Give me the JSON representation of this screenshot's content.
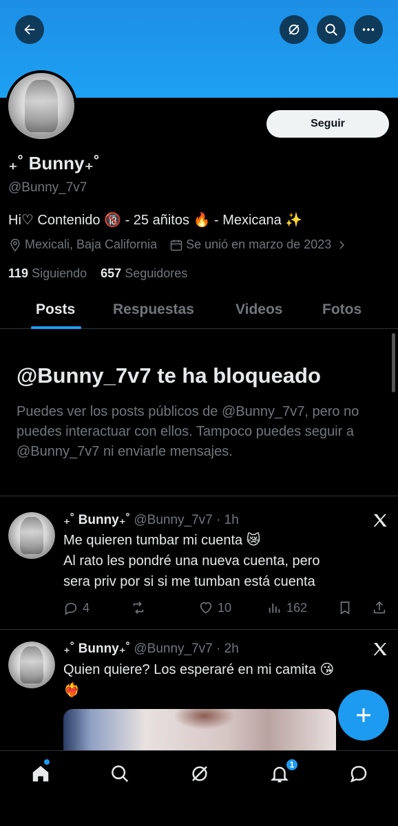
{
  "profile": {
    "display_name": "₊˚ Bunny₊˚",
    "handle": "@Bunny_7v7",
    "bio": "Hi♡ Contenido 🔞 - 25 añitos 🔥 - Mexicana ✨",
    "location": "Mexicali, Baja California",
    "joined": "Se unió en marzo de 2023",
    "following_count": "119",
    "following_label": "Siguiendo",
    "followers_count": "657",
    "followers_label": "Seguidores",
    "follow_button": "Seguir"
  },
  "header": {
    "back_icon": "back-arrow-icon",
    "grok_icon": "grok-icon",
    "search_icon": "search-icon",
    "more_icon": "more-icon"
  },
  "tabs": [
    {
      "label": "Posts",
      "active": true
    },
    {
      "label": "Respuestas",
      "active": false
    },
    {
      "label": "Videos",
      "active": false
    },
    {
      "label": "Fotos",
      "active": false
    }
  ],
  "blocked": {
    "title": "@Bunny_7v7 te ha bloqueado",
    "message": "Puedes ver los posts públicos de @Bunny_7v7, pero no puedes interactuar con ellos. Tampoco puedes seguir a @Bunny_7v7 ni enviarle mensajes."
  },
  "tweets": [
    {
      "name": "₊˚ Bunny₊˚",
      "handle": "@Bunny_7v7",
      "time": "· 1h",
      "text_line1": "Me quieren tumbar mi cuenta 😿",
      "text_line2": "Al rato les pondré una nueva cuenta, pero",
      "text_line3": "sera priv por si si me tumban está cuenta",
      "replies": "4",
      "retweets": "",
      "likes": "10",
      "views": "162"
    },
    {
      "name": "₊˚ Bunny₊˚",
      "handle": "@Bunny_7v7",
      "time": "· 2h",
      "text_line1": "Quien quiere? Los esperaré en mi camita 😘",
      "text_line2": "❤️‍🔥"
    }
  ],
  "nav": {
    "notifications_badge": "1"
  },
  "colors": {
    "accent": "#1d9bf0",
    "banner": "#1da1f2",
    "background": "#000000",
    "muted": "#71767b"
  }
}
